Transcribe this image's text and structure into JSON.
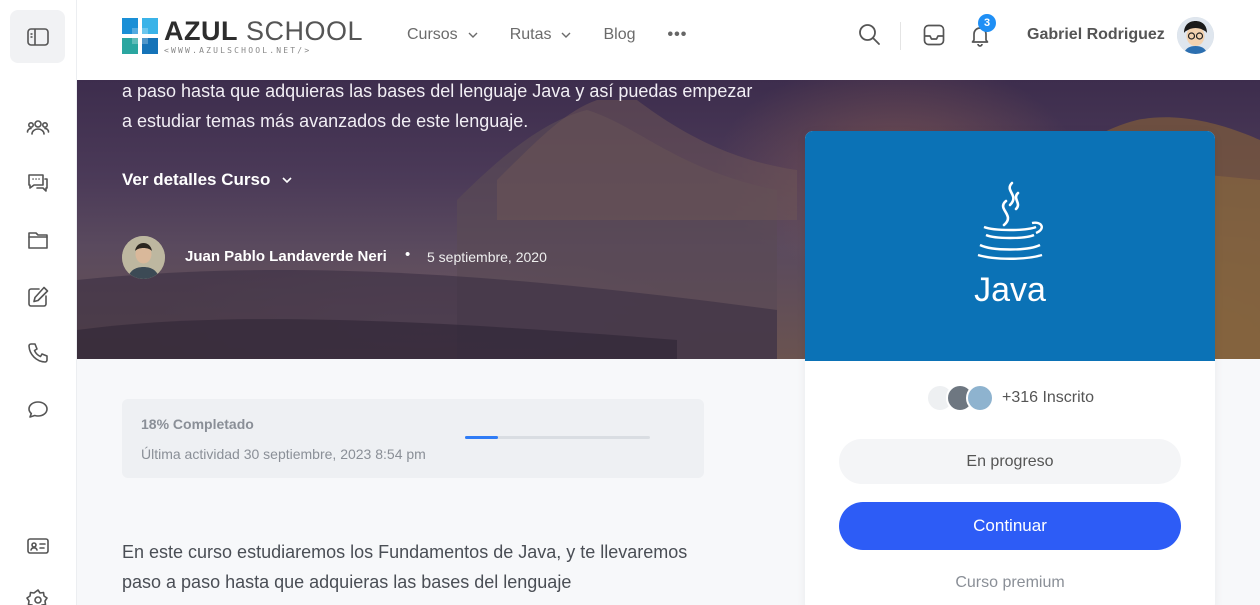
{
  "header": {
    "logo": {
      "name_bold": "AZUL",
      "name_light": " SCHOOL",
      "tagline": "<WWW.AZULSCHOOL.NET/>"
    },
    "nav": [
      {
        "label": "Cursos",
        "has_dropdown": true
      },
      {
        "label": "Rutas",
        "has_dropdown": true
      },
      {
        "label": "Blog",
        "has_dropdown": false
      }
    ],
    "more_label": "•••",
    "notification_count": "3",
    "user_name": "Gabriel Rodriguez",
    "icons": [
      "search-icon",
      "inbox-icon",
      "bell-icon"
    ]
  },
  "sidebar": {
    "icons": [
      "sidebar-toggle-icon",
      "groups-icon",
      "forums-icon",
      "folder-icon",
      "edit-icon",
      "phone-icon",
      "chat-icon",
      "id-card-icon",
      "settings-icon"
    ]
  },
  "hero": {
    "description": "a paso hasta que adquieras las bases del lenguaje Java y así puedas empezar a estudiar temas más avanzados de este lenguaje.",
    "details_label": "Ver detalles Curso",
    "author": "Juan Pablo Landaverde Neri",
    "separator": "•",
    "date": "5 septiembre, 2020"
  },
  "progress": {
    "title": "18% Completado",
    "percent": 18,
    "last_activity": "Última actividad 30 septiembre, 2023 8:54 pm"
  },
  "course_text": "En este curso estudiaremos los Fundamentos de Java, y te llevaremos paso a paso hasta que adquieras las bases del lenguaje",
  "card": {
    "banner_color": "#0b72b6",
    "logo_text": "Java",
    "enrolled": "+316 Inscrito",
    "status": "En progreso",
    "continue_label": "Continuar",
    "premium_label": "Curso premium"
  },
  "colors": {
    "accent": "#2d5cf6",
    "progress": "#2f7cf6",
    "badge": "#1f8ff5"
  }
}
